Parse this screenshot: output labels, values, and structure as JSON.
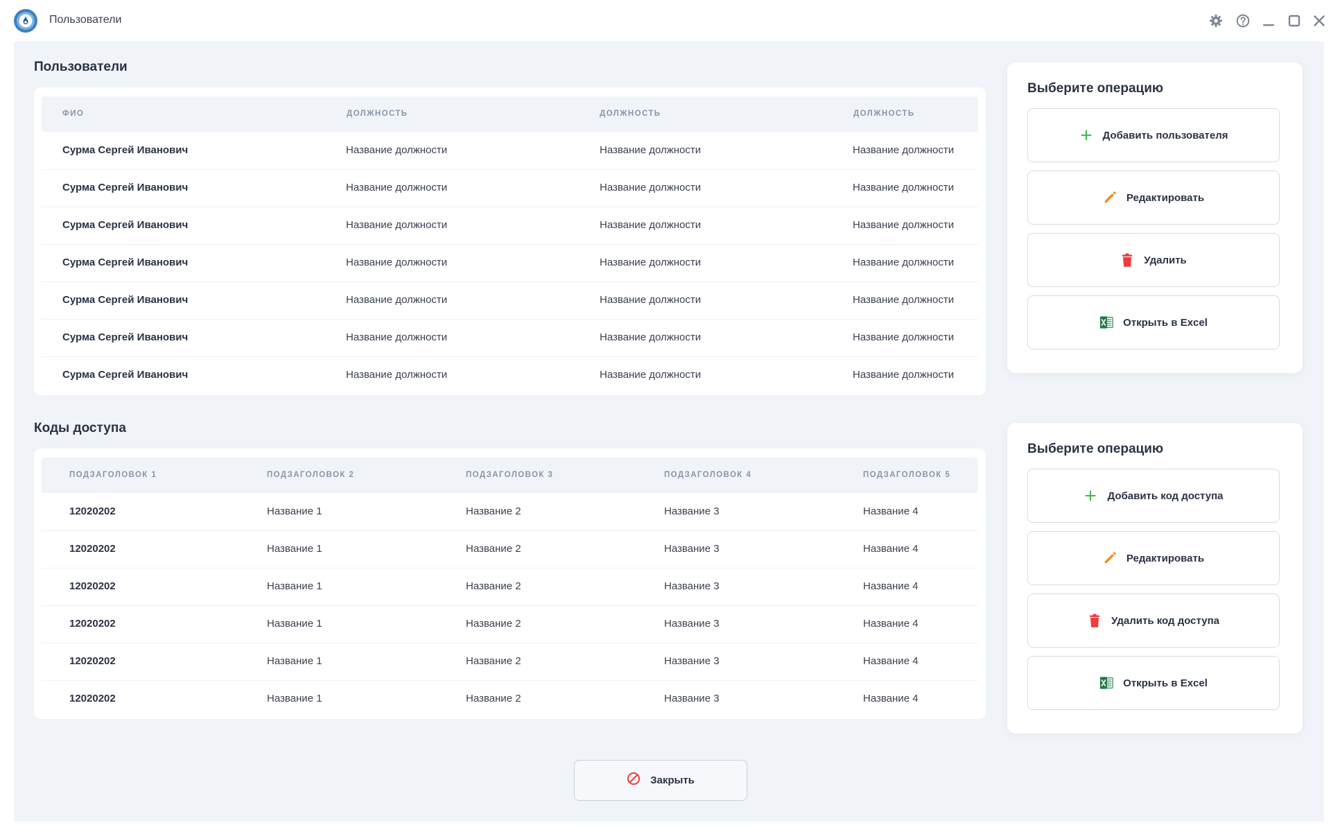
{
  "window": {
    "title": "Пользователи",
    "controls": [
      "gear-icon",
      "help-icon",
      "minimize-icon",
      "maximize-icon",
      "close-icon"
    ]
  },
  "users": {
    "section_title": "Пользователи",
    "columns": [
      "ФИО",
      "ДОЛЖНОСТЬ",
      "ДОЛЖНОСТЬ",
      "ДОЛЖНОСТЬ"
    ],
    "rows": [
      [
        "Сурма Сергей Иванович",
        "Название должности",
        "Название должности",
        "Название должности"
      ],
      [
        "Сурма Сергей Иванович",
        "Название должности",
        "Название должности",
        "Название должности"
      ],
      [
        "Сурма Сергей Иванович",
        "Название должности",
        "Название должности",
        "Название должности"
      ],
      [
        "Сурма Сергей Иванович",
        "Название должности",
        "Название должности",
        "Название должности"
      ],
      [
        "Сурма Сергей Иванович",
        "Название должности",
        "Название должности",
        "Название должности"
      ],
      [
        "Сурма Сергей Иванович",
        "Название должности",
        "Название должности",
        "Название должности"
      ],
      [
        "Сурма Сергей Иванович",
        "Название должности",
        "Название должности",
        "Название должности"
      ]
    ]
  },
  "codes": {
    "section_title": "Коды доступа",
    "columns": [
      "ПОДЗАГОЛОВОК 1",
      "ПОДЗАГОЛОВОК 2",
      "ПОДЗАГОЛОВОК 3",
      "ПОДЗАГОЛОВОК 4",
      "ПОДЗАГОЛОВОК 5"
    ],
    "rows": [
      [
        "12020202",
        "Название 1",
        "Название 2",
        "Название 3",
        "Название 4"
      ],
      [
        "12020202",
        "Название 1",
        "Название 2",
        "Название 3",
        "Название 4"
      ],
      [
        "12020202",
        "Название 1",
        "Название 2",
        "Название 3",
        "Название 4"
      ],
      [
        "12020202",
        "Название 1",
        "Название 2",
        "Название 3",
        "Название 4"
      ],
      [
        "12020202",
        "Название 1",
        "Название 2",
        "Название 3",
        "Название 4"
      ],
      [
        "12020202",
        "Название 1",
        "Название 2",
        "Название 3",
        "Название 4"
      ]
    ]
  },
  "user_ops": {
    "title": "Выберите операцию",
    "buttons": [
      {
        "label": "Добавить пользователя",
        "icon": "plus-icon"
      },
      {
        "label": "Редактировать",
        "icon": "pencil-icon"
      },
      {
        "label": "Удалить",
        "icon": "trash-icon"
      },
      {
        "label": "Открыть в Excel",
        "icon": "excel-icon"
      }
    ]
  },
  "code_ops": {
    "title": "Выберите операцию",
    "buttons": [
      {
        "label": "Добавить код доступа",
        "icon": "plus-icon"
      },
      {
        "label": "Редактировать",
        "icon": "pencil-icon"
      },
      {
        "label": "Удалить код доступа",
        "icon": "trash-icon"
      },
      {
        "label": "Открыть в Excel",
        "icon": "excel-icon"
      }
    ]
  },
  "close_button": {
    "label": "Закрыть",
    "icon": "cancel-icon"
  },
  "colors": {
    "accent_green": "#3db84a",
    "accent_orange": "#f08a24",
    "danger_red": "#ee3b3b",
    "excel_green": "#1f7a45",
    "background": "#f0f3f8"
  }
}
